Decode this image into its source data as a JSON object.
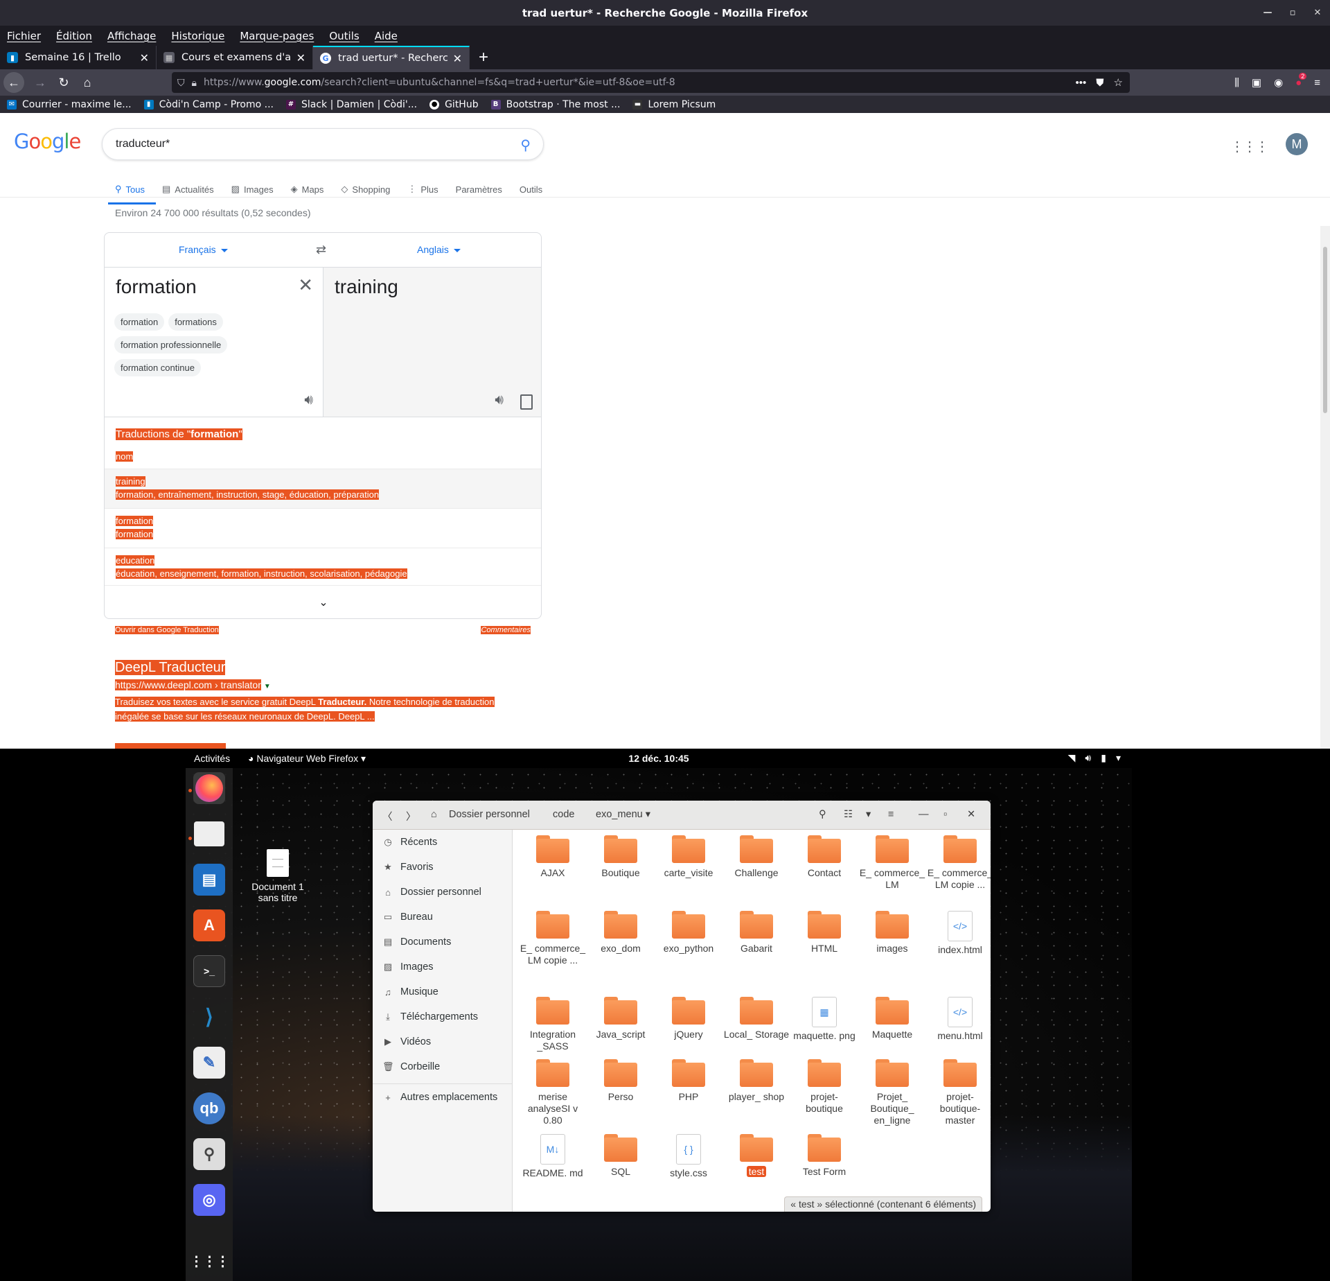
{
  "browser": {
    "window_title": "trad uertur* - Recherche Google - Mozilla Firefox",
    "menu": [
      "Fichier",
      "Édition",
      "Affichage",
      "Historique",
      "Marque-pages",
      "Outils",
      "Aide"
    ],
    "tabs": [
      {
        "label": "Semaine 16 | Trello",
        "active": false
      },
      {
        "label": "Cours et examens d'angl",
        "active": false
      },
      {
        "label": "trad uertur* - Recherche",
        "active": true
      }
    ],
    "url_prefix": "https://www.",
    "url_domain": "google.com",
    "url_rest": "/search?client=ubuntu&channel=fs&q=trad+uertur*&ie=utf-8&oe=utf-8",
    "notification_count": "2",
    "bookmarks": [
      "Courrier - maxime le...",
      "Còdi'n Camp - Promo ...",
      "Slack | Damien | Còdi'...",
      "GitHub",
      "Bootstrap · The most ...",
      "Lorem Picsum"
    ]
  },
  "google": {
    "logo": "Google",
    "query": "traducteur*",
    "avatar_letter": "M",
    "tabs": [
      "Tous",
      "Actualités",
      "Images",
      "Maps",
      "Shopping",
      "Plus",
      "Paramètres",
      "Outils"
    ],
    "stats": "Environ 24 700 000 résultats (0,52 secondes)",
    "translator": {
      "source_lang": "Français",
      "target_lang": "Anglais",
      "source_text": "formation",
      "target_text": "training",
      "suggestions": [
        "formation",
        "formations",
        "formation professionnelle",
        "formation continue"
      ],
      "heading_prefix": "Traductions de \"",
      "heading_word": "formation",
      "heading_suffix": "\"",
      "pos": "nom",
      "rows": [
        {
          "word": "training",
          "synonyms": "formation, entraînement, instruction, stage, éducation, préparation"
        },
        {
          "word": "formation",
          "synonyms": "formation"
        },
        {
          "word": "education",
          "synonyms": "éducation, enseignement, formation, instruction, scolarisation, pédagogie"
        }
      ],
      "open_link": "Ouvrir dans Google Traduction",
      "feedback": "Commentaires"
    },
    "result": {
      "title": "DeepL Traducteur",
      "url": "https://www.deepl.com › translator",
      "snippet_1": "Traduisez vos textes avec le service gratuit DeepL ",
      "snippet_bold": "Traducteur.",
      "snippet_2": " Notre technologie de traduction inégalée se base sur les réseaux neuronaux de DeepL. DeepL ..."
    }
  },
  "gnome": {
    "activities": "Activités",
    "app_menu": "Navigateur Web Firefox",
    "clock": "12 déc.  10:45"
  },
  "desktop_icon": {
    "line1": "Document 1",
    "line2": "sans titre"
  },
  "nautilus": {
    "path": [
      "Dossier personnel",
      "code",
      "exo_menu"
    ],
    "sidebar": [
      "Récents",
      "Favoris",
      "Dossier personnel",
      "Bureau",
      "Documents",
      "Images",
      "Musique",
      "Téléchargements",
      "Vidéos",
      "Corbeille",
      "Autres emplacements"
    ],
    "files": [
      [
        "AJAX",
        "Boutique",
        "carte_visite",
        "Challenge",
        "Contact",
        "E_ commerce_ LM",
        "E_ commerce_ LM copie ..."
      ],
      [
        "E_ commerce_ LM copie ...",
        "exo_dom",
        "exo_python",
        "Gabarit",
        "HTML",
        "images",
        "index.html"
      ],
      [
        "Integration _SASS",
        "Java_script",
        "jQuery",
        "Local_ Storage",
        "maquette. png",
        "Maquette",
        "menu.html"
      ],
      [
        "merise analyseSI v 0.80",
        "Perso",
        "PHP",
        "player_ shop",
        "projet- boutique",
        "Projet_ Boutique_ en_ligne",
        "projet- boutique- master"
      ],
      [
        "README. md",
        "SQL",
        "style.css",
        "test",
        "Test Form"
      ]
    ],
    "status": "« test » sélectionné  (contenant 6 éléments)"
  }
}
